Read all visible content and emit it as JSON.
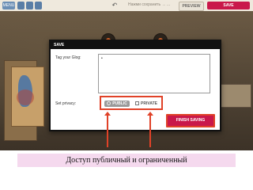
{
  "toolbar": {
    "menu_label": "MENU",
    "hint": "Нажми сохранить → ...",
    "preview_label": "PREVIEW",
    "save_label": "SAVE",
    "undo_icon": "undo-icon"
  },
  "dialog": {
    "title": "SAVE",
    "tag_label": "Tag your Glog:",
    "tag_value": "•",
    "privacy_label": "Set privacy:",
    "public_label": "PUBLIC",
    "private_label": "PRIVATE",
    "finish_label": "FINISH SAVING"
  },
  "caption": "Доступ публичный и ограниченный",
  "colors": {
    "accent": "#c9184a",
    "highlight": "#e04228",
    "caption_bg": "#f5d9ee"
  }
}
